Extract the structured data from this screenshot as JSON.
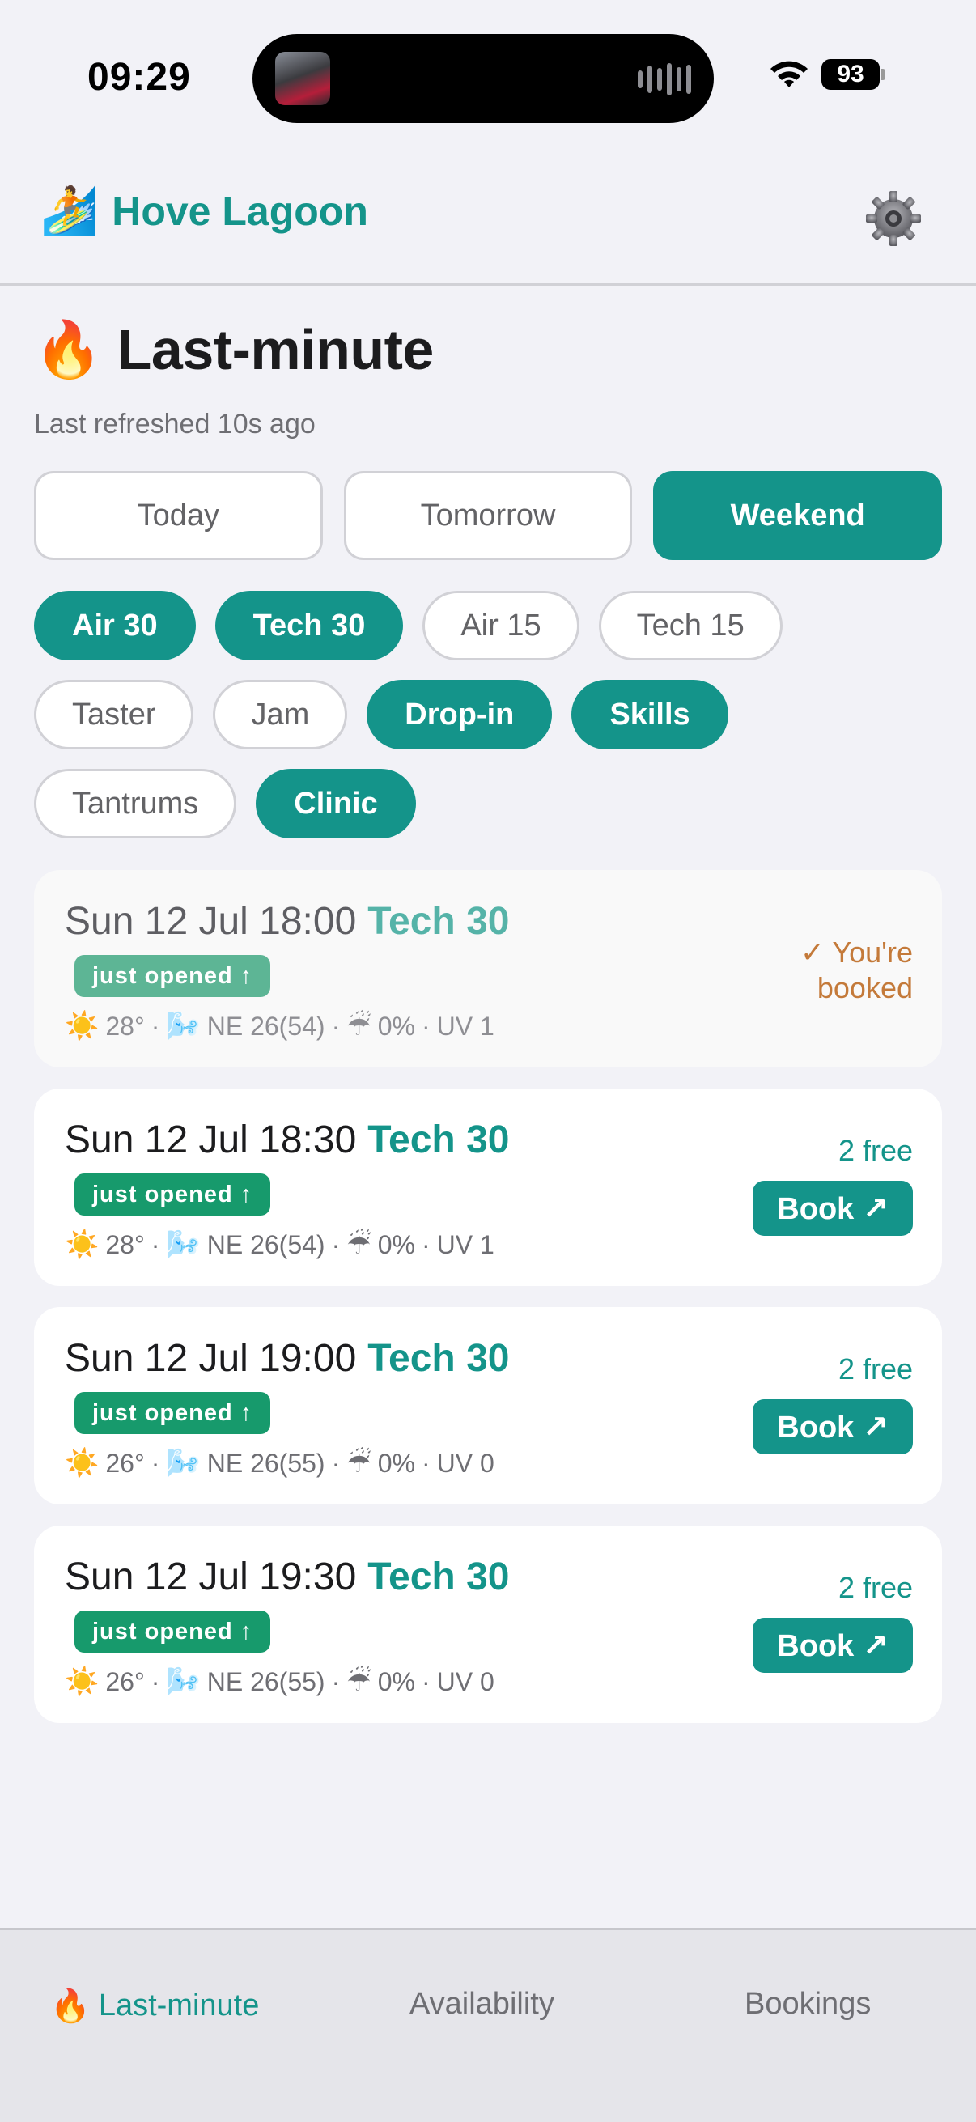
{
  "status_bar": {
    "time": "09:29",
    "battery": "93"
  },
  "header": {
    "brand_emoji": "🏄",
    "brand_name": "Hove Lagoon",
    "settings_icon": "gear-icon"
  },
  "page": {
    "title_emoji": "🔥",
    "title": "Last-minute",
    "refreshed": "Last refreshed 10s ago"
  },
  "day_tabs": [
    {
      "label": "Today",
      "active": false
    },
    {
      "label": "Tomorrow",
      "active": false
    },
    {
      "label": "Weekend",
      "active": true
    }
  ],
  "filters": [
    {
      "label": "Air 30",
      "active": true
    },
    {
      "label": "Tech 30",
      "active": true
    },
    {
      "label": "Air 15",
      "active": false
    },
    {
      "label": "Tech 15",
      "active": false
    },
    {
      "label": "Taster",
      "active": false
    },
    {
      "label": "Jam",
      "active": false
    },
    {
      "label": "Drop-in",
      "active": true
    },
    {
      "label": "Skills",
      "active": true
    },
    {
      "label": "Tantrums",
      "active": false
    },
    {
      "label": "Clinic",
      "active": true
    }
  ],
  "sessions": [
    {
      "when": "Sun 12 Jul 18:00",
      "type": "Tech 30",
      "badge": "just opened ↑",
      "temp": "28°",
      "wind": "NE 26(54)",
      "rain": "0%",
      "uv": "UV 1",
      "booked": true,
      "booked_line1": "✓ You're",
      "booked_line2": "booked"
    },
    {
      "when": "Sun 12 Jul 18:30",
      "type": "Tech 30",
      "badge": "just opened ↑",
      "temp": "28°",
      "wind": "NE 26(54)",
      "rain": "0%",
      "uv": "UV 1",
      "booked": false,
      "free": "2 free",
      "book_label": "Book ↗"
    },
    {
      "when": "Sun 12 Jul 19:00",
      "type": "Tech 30",
      "badge": "just opened ↑",
      "temp": "26°",
      "wind": "NE 26(55)",
      "rain": "0%",
      "uv": "UV 0",
      "booked": false,
      "free": "2 free",
      "book_label": "Book ↗"
    },
    {
      "when": "Sun 12 Jul 19:30",
      "type": "Tech 30",
      "badge": "just opened ↑",
      "temp": "26°",
      "wind": "NE 26(55)",
      "rain": "0%",
      "uv": "UV 0",
      "booked": false,
      "free": "2 free",
      "book_label": "Book ↗"
    }
  ],
  "weather_icons": {
    "sun": "☀️",
    "wind": "🌬️",
    "rain": "☔"
  },
  "separator": "·",
  "bottom_nav": [
    {
      "emoji": "🔥",
      "label": "Last-minute",
      "active": true
    },
    {
      "label": "Availability",
      "active": false
    },
    {
      "label": "Bookings",
      "active": false
    }
  ],
  "colors": {
    "accent": "#14948a",
    "badge": "#179a6c",
    "booked_text": "#c47a3a",
    "background": "#f2f2f7"
  }
}
